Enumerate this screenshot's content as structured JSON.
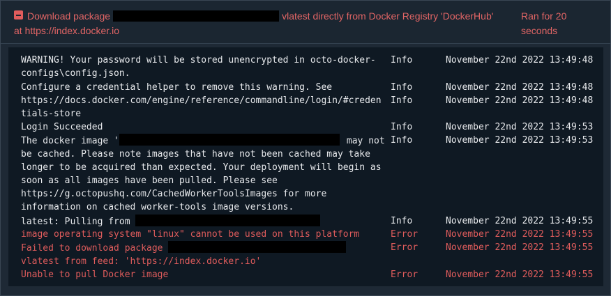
{
  "header": {
    "title_prefix": "Download package",
    "title_suffix": "vlatest directly from Docker Registry  'DockerHub'",
    "title_line2": "at https://index.docker.io",
    "duration": "Ran for 20 seconds",
    "status_icon": "minus-square-icon",
    "accent_color": "#e05c5c"
  },
  "log": {
    "rows": [
      {
        "lines": [
          "WARNING! Your password will be stored unencrypted in octo-docker-",
          "configs\\config.json."
        ],
        "level": "Info",
        "time": "November 22nd 2022 13:49:48"
      },
      {
        "lines": [
          "Configure a credential helper to remove this warning. See"
        ],
        "level": "Info",
        "time": "November 22nd 2022 13:49:48"
      },
      {
        "lines": [
          "https://docs.docker.com/engine/reference/commandline/login/#creden",
          "tials-store"
        ],
        "level": "Info",
        "time": "November 22nd 2022 13:49:48"
      },
      {
        "lines": [
          "Login Succeeded"
        ],
        "level": "Info",
        "time": "November 22nd 2022 13:49:53"
      },
      {
        "prefix": "The docker image '",
        "suffix": "may not",
        "lines": [
          "be cached. Please note images that have not been cached may take",
          "longer to be acquired than expected. Your deployment will begin as",
          "soon as all images have been pulled. Please see",
          "https://g.octopushq.com/CachedWorkerToolsImages for more",
          "information on cached worker-tools image versions."
        ],
        "level": "Info",
        "time": "November 22nd 2022 13:49:53"
      },
      {
        "prefix": "latest: Pulling from ",
        "level": "Info",
        "time": "November 22nd 2022 13:49:55"
      },
      {
        "lines": [
          "image operating system \"linux\" cannot be used on this platform"
        ],
        "level": "Error",
        "time": "November 22nd 2022 13:49:55"
      },
      {
        "prefix": "Failed to download package ",
        "lines": [
          "vlatest from feed: 'https://index.docker.io'"
        ],
        "level": "Error",
        "time": "November 22nd 2022 13:49:55"
      },
      {
        "lines": [
          "Unable to pull Docker image"
        ],
        "level": "Error",
        "time": "November 22nd 2022 13:49:55"
      }
    ]
  }
}
